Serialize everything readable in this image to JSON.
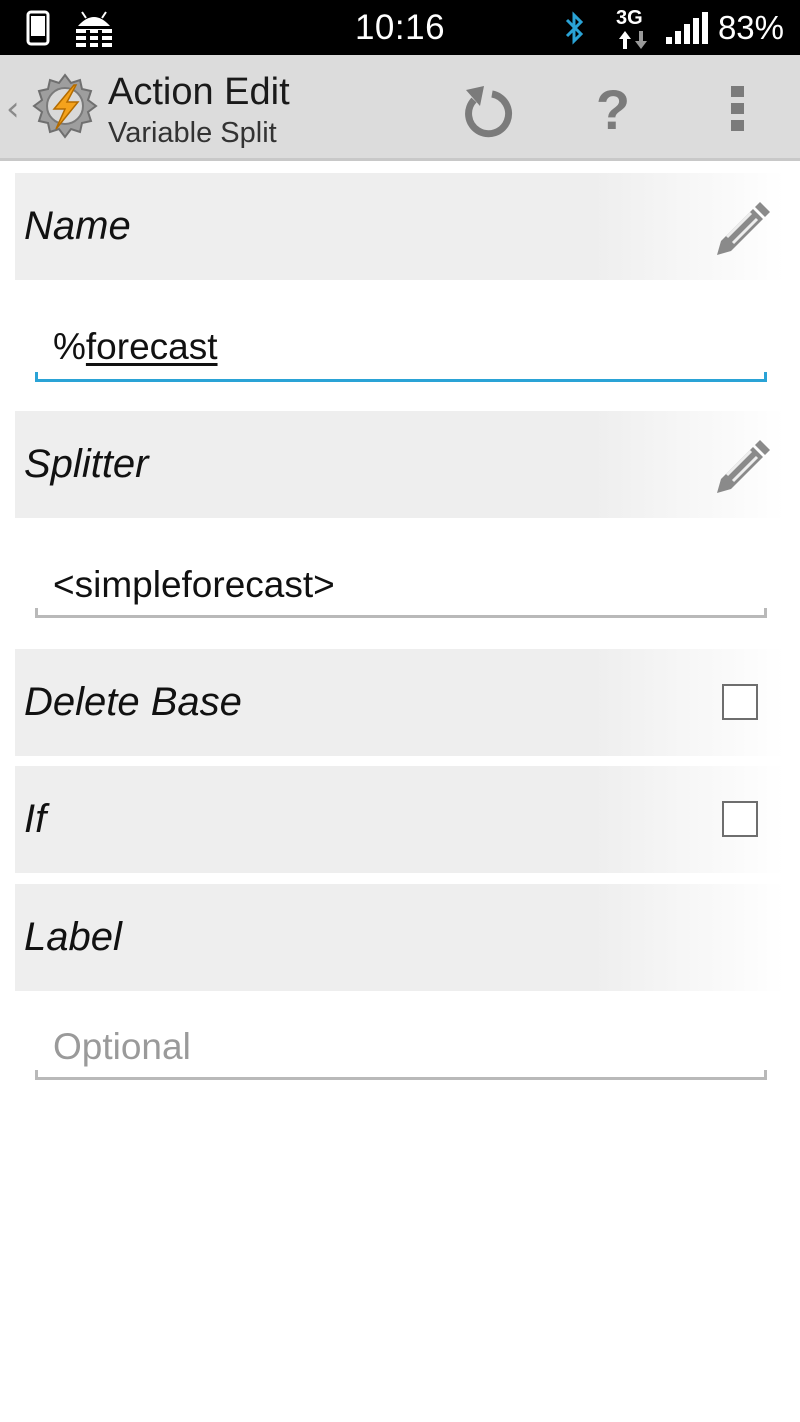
{
  "status_bar": {
    "time": "10:16",
    "battery": "83%",
    "network": "3G",
    "icons": [
      "phone-icon",
      "android-debug-icon",
      "bluetooth-icon",
      "network-3g-icon",
      "signal-icon"
    ],
    "bluetooth_color": "#2aa3d6"
  },
  "action_bar": {
    "title": "Action Edit",
    "subtitle": "Variable Split",
    "back_glyph": "‹",
    "help_glyph": "?",
    "icons": [
      "tasker-logo-icon",
      "undo-icon",
      "help-icon",
      "overflow-menu-icon"
    ]
  },
  "sections": {
    "name": {
      "label": "Name",
      "value_prefix": "%",
      "value_main": "forecast"
    },
    "splitter": {
      "label": "Splitter",
      "value": "<simpleforecast>"
    },
    "delete_base": {
      "label": "Delete Base",
      "checked": false
    },
    "if": {
      "label": "If",
      "checked": false
    },
    "label": {
      "label": "Label",
      "placeholder": "Optional"
    }
  },
  "colors": {
    "accent": "#2aa3d6",
    "action_bar_bg": "#dcdcdc",
    "section_bg": "#eeeeee"
  }
}
